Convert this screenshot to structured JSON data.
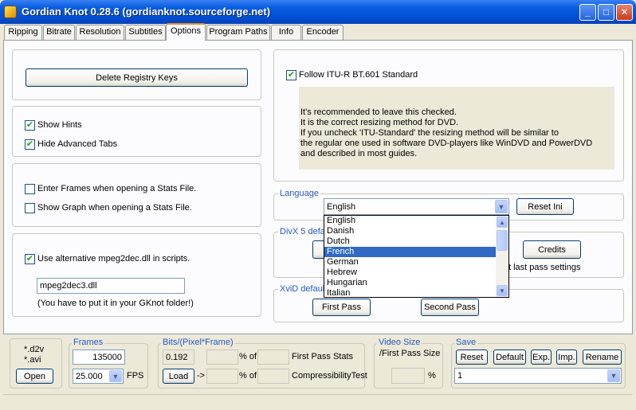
{
  "window": {
    "title": "Gordian Knot 0.28.6 (gordianknot.sourceforge.net)"
  },
  "tabs": [
    {
      "label": "Ripping"
    },
    {
      "label": "Bitrate"
    },
    {
      "label": "Resolution"
    },
    {
      "label": "Subtitles"
    },
    {
      "label": "Options"
    },
    {
      "label": "Program Paths"
    },
    {
      "label": "Info"
    },
    {
      "label": "Encoder"
    }
  ],
  "active_tab": "Options",
  "options": {
    "delete_registry_label": "Delete Registry Keys",
    "show_hints": {
      "label": "Show Hints",
      "checked": true
    },
    "hide_advanced": {
      "label": "Hide Advanced Tabs",
      "checked": true
    },
    "enter_frames": {
      "label": "Enter Frames when opening a Stats File.",
      "checked": false
    },
    "show_graph": {
      "label": "Show Graph when opening a Stats File.",
      "checked": false
    },
    "alt_mpeg2dec": {
      "label": "Use alternative mpeg2dec.dll in scripts.",
      "checked": true
    },
    "mpeg2dec_value": "mpeg2dec3.dll",
    "mpeg2dec_note": "(You have to put it in your GKnot folder!)",
    "follow_itu": {
      "label": "Follow ITU-R BT.601 Standard",
      "checked": true
    },
    "itu_note": [
      "It's recommended  to leave this checked.",
      "It is the correct resizing method for DVD.",
      "If you uncheck 'ITU-Standard' the resizing method will be similar to",
      "the regular one used in software DVD-players like WinDVD and PowerDVD",
      "and described in most guides."
    ],
    "language_label": "Language",
    "language_value": "English",
    "language_options": [
      "English",
      "Danish",
      "Dutch",
      "French",
      "German",
      "Hebrew",
      "Hungarian",
      "Italian"
    ],
    "language_highlighted": "French",
    "reset_ini_label": "Reset Ini",
    "divx_label": "DivX 5 defa",
    "credits_label": "Credits",
    "last_pass_text": "t last pass settings",
    "xvid_label": "XviD defaul",
    "first_pass_label": "First Pass",
    "second_pass_label": "Second Pass"
  },
  "bottom": {
    "d2v_label": "*.d2v",
    "avi_label": "*.avi",
    "open_label": "Open",
    "frames_group": "Frames",
    "frames_value": "135000",
    "fps_value": "25.000",
    "fps_label": "FPS",
    "bits_group": "Bits/(Pixel*Frame)",
    "bits_value": "0.192",
    "load_label": "Load",
    "arrow_label": "->",
    "percent_of_1": "% of",
    "percent_of_2": "% of",
    "first_pass_stats": "First Pass Stats",
    "compress_test": "CompressibilityTest",
    "video_size_group": "Video Size",
    "first_pass_size": "/First Pass Size",
    "percent_sign": "%",
    "save_group": "Save",
    "save_buttons": [
      "Reset",
      "Default",
      "Exp.",
      "Imp.",
      "Rename"
    ],
    "save_select_value": "1"
  }
}
